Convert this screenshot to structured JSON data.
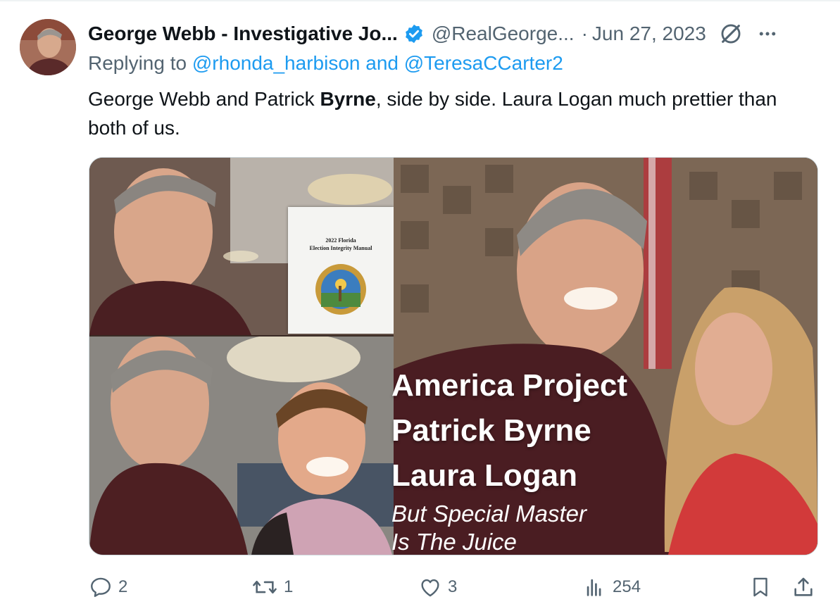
{
  "tweet": {
    "author_name": "George Webb - Investigative Jo...",
    "handle": "@RealGeorge...",
    "separator": "·",
    "date": "Jun 27, 2023",
    "replying_prefix": "Replying to ",
    "replying_to_1": "@rhonda_harbison",
    "replying_joiner": " and ",
    "replying_to_2": "@TeresaCCarter2",
    "text_before": "George Webb and Patrick ",
    "text_bold": "Byrne",
    "text_after": ", side by side. Laura Logan much prettier than both of us.",
    "verified_color": "#1d9bf0",
    "link_color": "#1d9bf0"
  },
  "media": {
    "manual_title_line1": "2022 Florida",
    "manual_title_line2": "Election Integrity Manual",
    "overlay_line1": "America Project",
    "overlay_line2": "Patrick Byrne",
    "overlay_line3": "Laura Logan",
    "overlay_sub1": "But Special Master",
    "overlay_sub2": "Is The Juice"
  },
  "actions": {
    "replies": "2",
    "retweets": "1",
    "likes": "3",
    "views": "254"
  },
  "icons": [
    "verified-icon",
    "grok-icon",
    "more-icon",
    "reply-icon",
    "retweet-icon",
    "like-icon",
    "views-icon",
    "bookmark-icon",
    "share-icon"
  ]
}
